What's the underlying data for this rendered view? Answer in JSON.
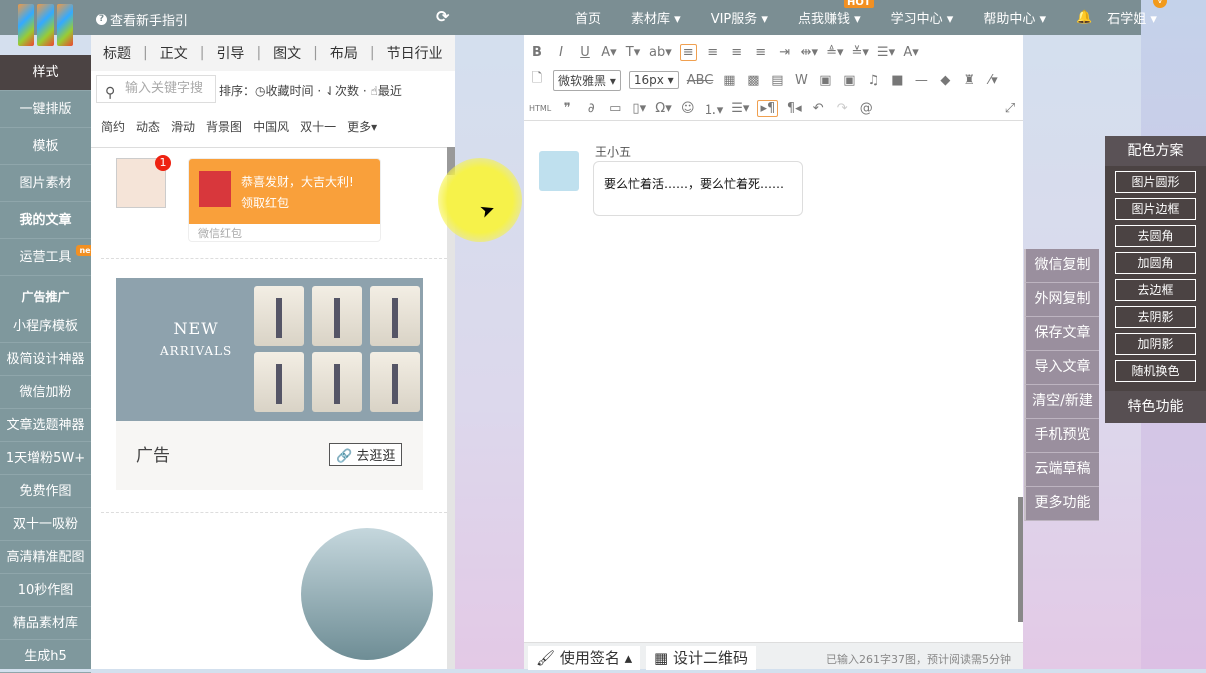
{
  "header": {
    "guide": "查看新手指引",
    "nav": [
      "首页",
      "素材库",
      "VIP服务",
      "点我赚钱",
      "学习中心",
      "帮助中心"
    ],
    "hot": "HOT",
    "user": "石学姐",
    "user_badge": "v"
  },
  "sidebar": {
    "items": [
      "样式",
      "一键排版",
      "模板",
      "图片素材",
      "我的文章",
      "运营工具"
    ],
    "new_badge": "new",
    "section": "广告推广",
    "ads": [
      "小程序模板",
      "极简设计神器",
      "微信加粉",
      "文章选题神器",
      "1天增粉5W+",
      "免费作图",
      "双十一吸粉",
      "高清精准配图",
      "10秒作图",
      "精品素材库",
      "生成h5"
    ]
  },
  "panel": {
    "tabs": [
      "标题",
      "正文",
      "引导",
      "图文",
      "布局",
      "节日行业"
    ],
    "search_placeholder": "输入关键字搜",
    "sort_label": "排序：",
    "sort": [
      "收藏时间",
      "次数",
      "最近"
    ],
    "cats": [
      "简约",
      "动态",
      "滑动",
      "背景图",
      "中国风",
      "双十一",
      "更多▾"
    ],
    "redpacket": {
      "badge": "1",
      "line1": "恭喜发财，大吉大利!",
      "line2": "领取红包",
      "footer": "微信红包"
    },
    "ad": {
      "line1": "NEW",
      "line2": "ARRIVALS",
      "label": "广告",
      "button": "去逛逛"
    }
  },
  "editor": {
    "font": "微软雅黑",
    "size": "16px",
    "html": "HTML",
    "message": {
      "name": "王小五",
      "text": "要么忙着活……，要么忙着死……"
    },
    "bottom": {
      "sign": "使用签名",
      "qr": "设计二维码",
      "count": "已输入261字37图，预计阅读需5分钟"
    }
  },
  "actions": [
    "微信复制",
    "外网复制",
    "保存文章",
    "导入文章",
    "清空/新建",
    "手机预览",
    "云端草稿",
    "更多功能"
  ],
  "scheme": {
    "title": "配色方案",
    "buttons": [
      "图片圆形",
      "图片边框",
      "去圆角",
      "加圆角",
      "去边框",
      "去阴影",
      "加阴影",
      "随机换色"
    ],
    "footer": "特色功能"
  }
}
